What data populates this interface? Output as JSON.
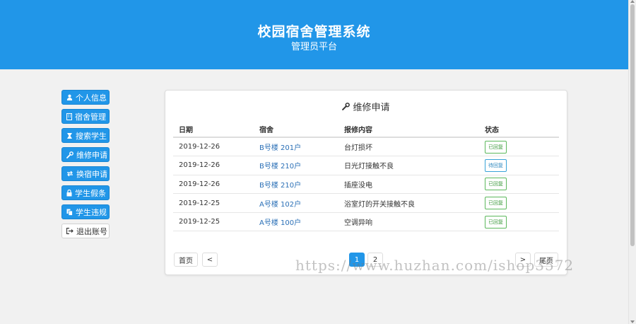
{
  "header": {
    "title": "校园宿舍管理系统",
    "subtitle": "管理员平台"
  },
  "sidebar": {
    "items": [
      {
        "label": "个人信息",
        "icon": "user-icon"
      },
      {
        "label": "宿舍管理",
        "icon": "building-icon"
      },
      {
        "label": "搜索学生",
        "icon": "search-student-icon"
      },
      {
        "label": "维修申请",
        "icon": "wrench-icon"
      },
      {
        "label": "换宿申请",
        "icon": "swap-icon"
      },
      {
        "label": "学生假条",
        "icon": "lock-icon"
      },
      {
        "label": "学生违规",
        "icon": "copy-icon"
      },
      {
        "label": "退出账号",
        "icon": "logout-icon"
      }
    ]
  },
  "panel": {
    "title": "维修申请",
    "columns": [
      "日期",
      "宿舍",
      "报修内容",
      "状态"
    ],
    "rows": [
      {
        "date": "2019-12-26",
        "dorm": "B号楼 201户",
        "content": "台灯损坏",
        "status": "已回复"
      },
      {
        "date": "2019-12-26",
        "dorm": "B号楼 210户",
        "content": "日光灯接触不良",
        "status": "待回复"
      },
      {
        "date": "2019-12-26",
        "dorm": "B号楼 210户",
        "content": "插座没电",
        "status": "已回复"
      },
      {
        "date": "2019-12-25",
        "dorm": "A号楼 102户",
        "content": "浴室灯的开关接触不良",
        "status": "已回复"
      },
      {
        "date": "2019-12-25",
        "dorm": "A号楼 100户",
        "content": "空调异响",
        "status": "已回复"
      }
    ]
  },
  "pagination": {
    "first": "首页",
    "prev": "<",
    "pages": [
      "1",
      "2"
    ],
    "next": ">",
    "last": "尾页"
  },
  "watermark": "https://www.huzhan.com/ishop3572",
  "colors": {
    "primary": "#2196e8",
    "replied": "#5cb85c",
    "pending": "#39a3d8"
  }
}
